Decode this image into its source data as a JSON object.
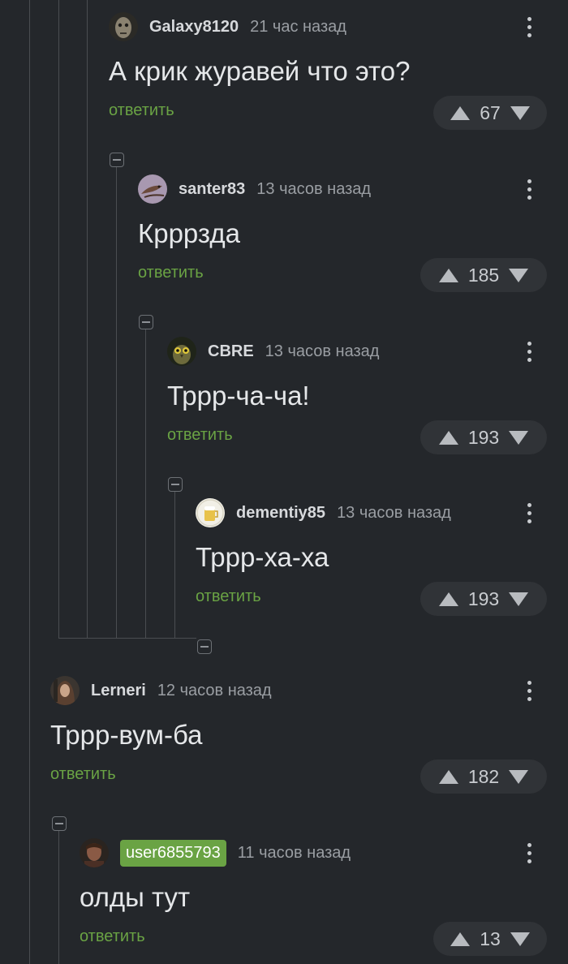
{
  "comments": [
    {
      "username": "Galaxy8120",
      "time": "21 час назад",
      "text": "А крик журавей что это?",
      "reply_label": "ответить",
      "rating": "67",
      "avatar_icon": "face-avatar-icon",
      "username_badge": false
    },
    {
      "username": "santer83",
      "time": "13 часов назад",
      "text": "Крррзда",
      "reply_label": "ответить",
      "rating": "185",
      "avatar_icon": "lizard-avatar-icon",
      "username_badge": false
    },
    {
      "username": "CBRE",
      "time": "13 часов назад",
      "text": "Трpp-ча-ча!",
      "reply_label": "ответить",
      "rating": "193",
      "avatar_icon": "owl-avatar-icon",
      "username_badge": false
    },
    {
      "username": "dementiy85",
      "time": "13 часов назад",
      "text": "Трpp-ха-ха",
      "reply_label": "ответить",
      "rating": "193",
      "avatar_icon": "beer-avatar-icon",
      "username_badge": false
    },
    {
      "username": "Lerneri",
      "time": "12 часов назад",
      "text": "Трpp-вум-ба",
      "reply_label": "ответить",
      "rating": "182",
      "avatar_icon": "girl-avatar-icon",
      "username_badge": false
    },
    {
      "username": "user6855793",
      "time": "11 часов назад",
      "text": "олды тут",
      "reply_label": "ответить",
      "rating": "13",
      "avatar_icon": "person-avatar-icon",
      "username_badge": true
    }
  ],
  "colors": {
    "background": "#24272b",
    "reply_link": "#6aa344",
    "username_badge": "#6aa344",
    "thread_line": "#4a4d51",
    "vote_pill": "#303337"
  }
}
